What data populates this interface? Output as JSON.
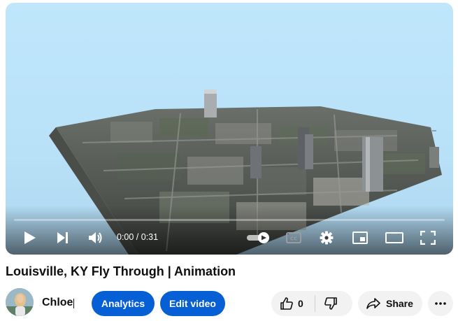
{
  "video": {
    "time_current": "0:00",
    "time_total": "0:31",
    "time_display": "0:00 / 0:31",
    "progress": 0
  },
  "title": "Louisville, KY Fly Through | Animation",
  "channel": {
    "name": "Chloe"
  },
  "buttons": {
    "analytics": "Analytics",
    "edit_video": "Edit video",
    "share": "Share"
  },
  "likes": {
    "count": "0"
  },
  "icons": [
    "play-icon",
    "next-icon",
    "volume-icon",
    "autoplay-toggle",
    "captions-icon",
    "settings-icon",
    "miniplayer-icon",
    "theater-icon",
    "fullscreen-icon",
    "thumbs-up-icon",
    "thumbs-down-icon",
    "share-icon",
    "more-icon"
  ],
  "colors": {
    "accent": "#065fd4",
    "progress": "#ff0000",
    "sky": "#bfe6fb"
  }
}
